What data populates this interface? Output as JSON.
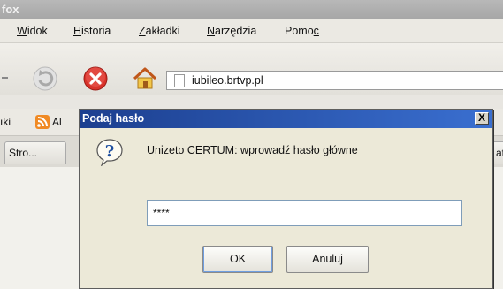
{
  "window": {
    "title_fragment": "fox"
  },
  "menubar": {
    "items": [
      {
        "label": "Widok",
        "underline": "W"
      },
      {
        "label": "Historia",
        "underline": "H"
      },
      {
        "label": "Zakładki",
        "underline": "Z"
      },
      {
        "label": "Narzędzia",
        "underline": "N"
      },
      {
        "label": "Pomoc",
        "underline": "c"
      }
    ]
  },
  "navbar": {
    "url": "iubileo.brtvp.pl"
  },
  "bookmarks": {
    "left_fragment": "ıki",
    "rss_fragment": "Al"
  },
  "tabs": {
    "left_tab": "Stro...",
    "right_fragment": "at:"
  },
  "dialog": {
    "title": "Podaj hasło",
    "close_label": "X",
    "message": "Unizeto CERTUM: wprowadź hasło główne",
    "password_value": "****",
    "ok_label": "OK",
    "cancel_label": "Anuluj"
  }
}
